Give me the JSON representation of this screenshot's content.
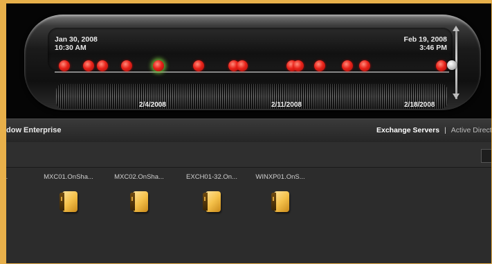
{
  "timeline": {
    "start_date": "Jan 30, 2008",
    "start_time": "10:30 AM",
    "end_date": "Feb 19, 2008",
    "end_time": "3:46 PM",
    "ticks": [
      "2/4/2008",
      "2/11/2008",
      "2/18/2008"
    ],
    "event_color": "#e8231a",
    "highlight_color": "#7ac83c"
  },
  "header": {
    "app_title": "dow Enterprise",
    "nav_active": "Exchange Servers",
    "nav_separator": "|",
    "nav_next": "Active Direct"
  },
  "servers": [
    {
      "label": "ad...",
      "icon": "server-icon"
    },
    {
      "label": "MXC01.OnSha...",
      "icon": "server-icon"
    },
    {
      "label": "MXC02.OnSha...",
      "icon": "server-icon"
    },
    {
      "label": "EXCH01-32.On...",
      "icon": "server-icon"
    },
    {
      "label": "WINXP01.OnS...",
      "icon": "server-icon"
    }
  ]
}
